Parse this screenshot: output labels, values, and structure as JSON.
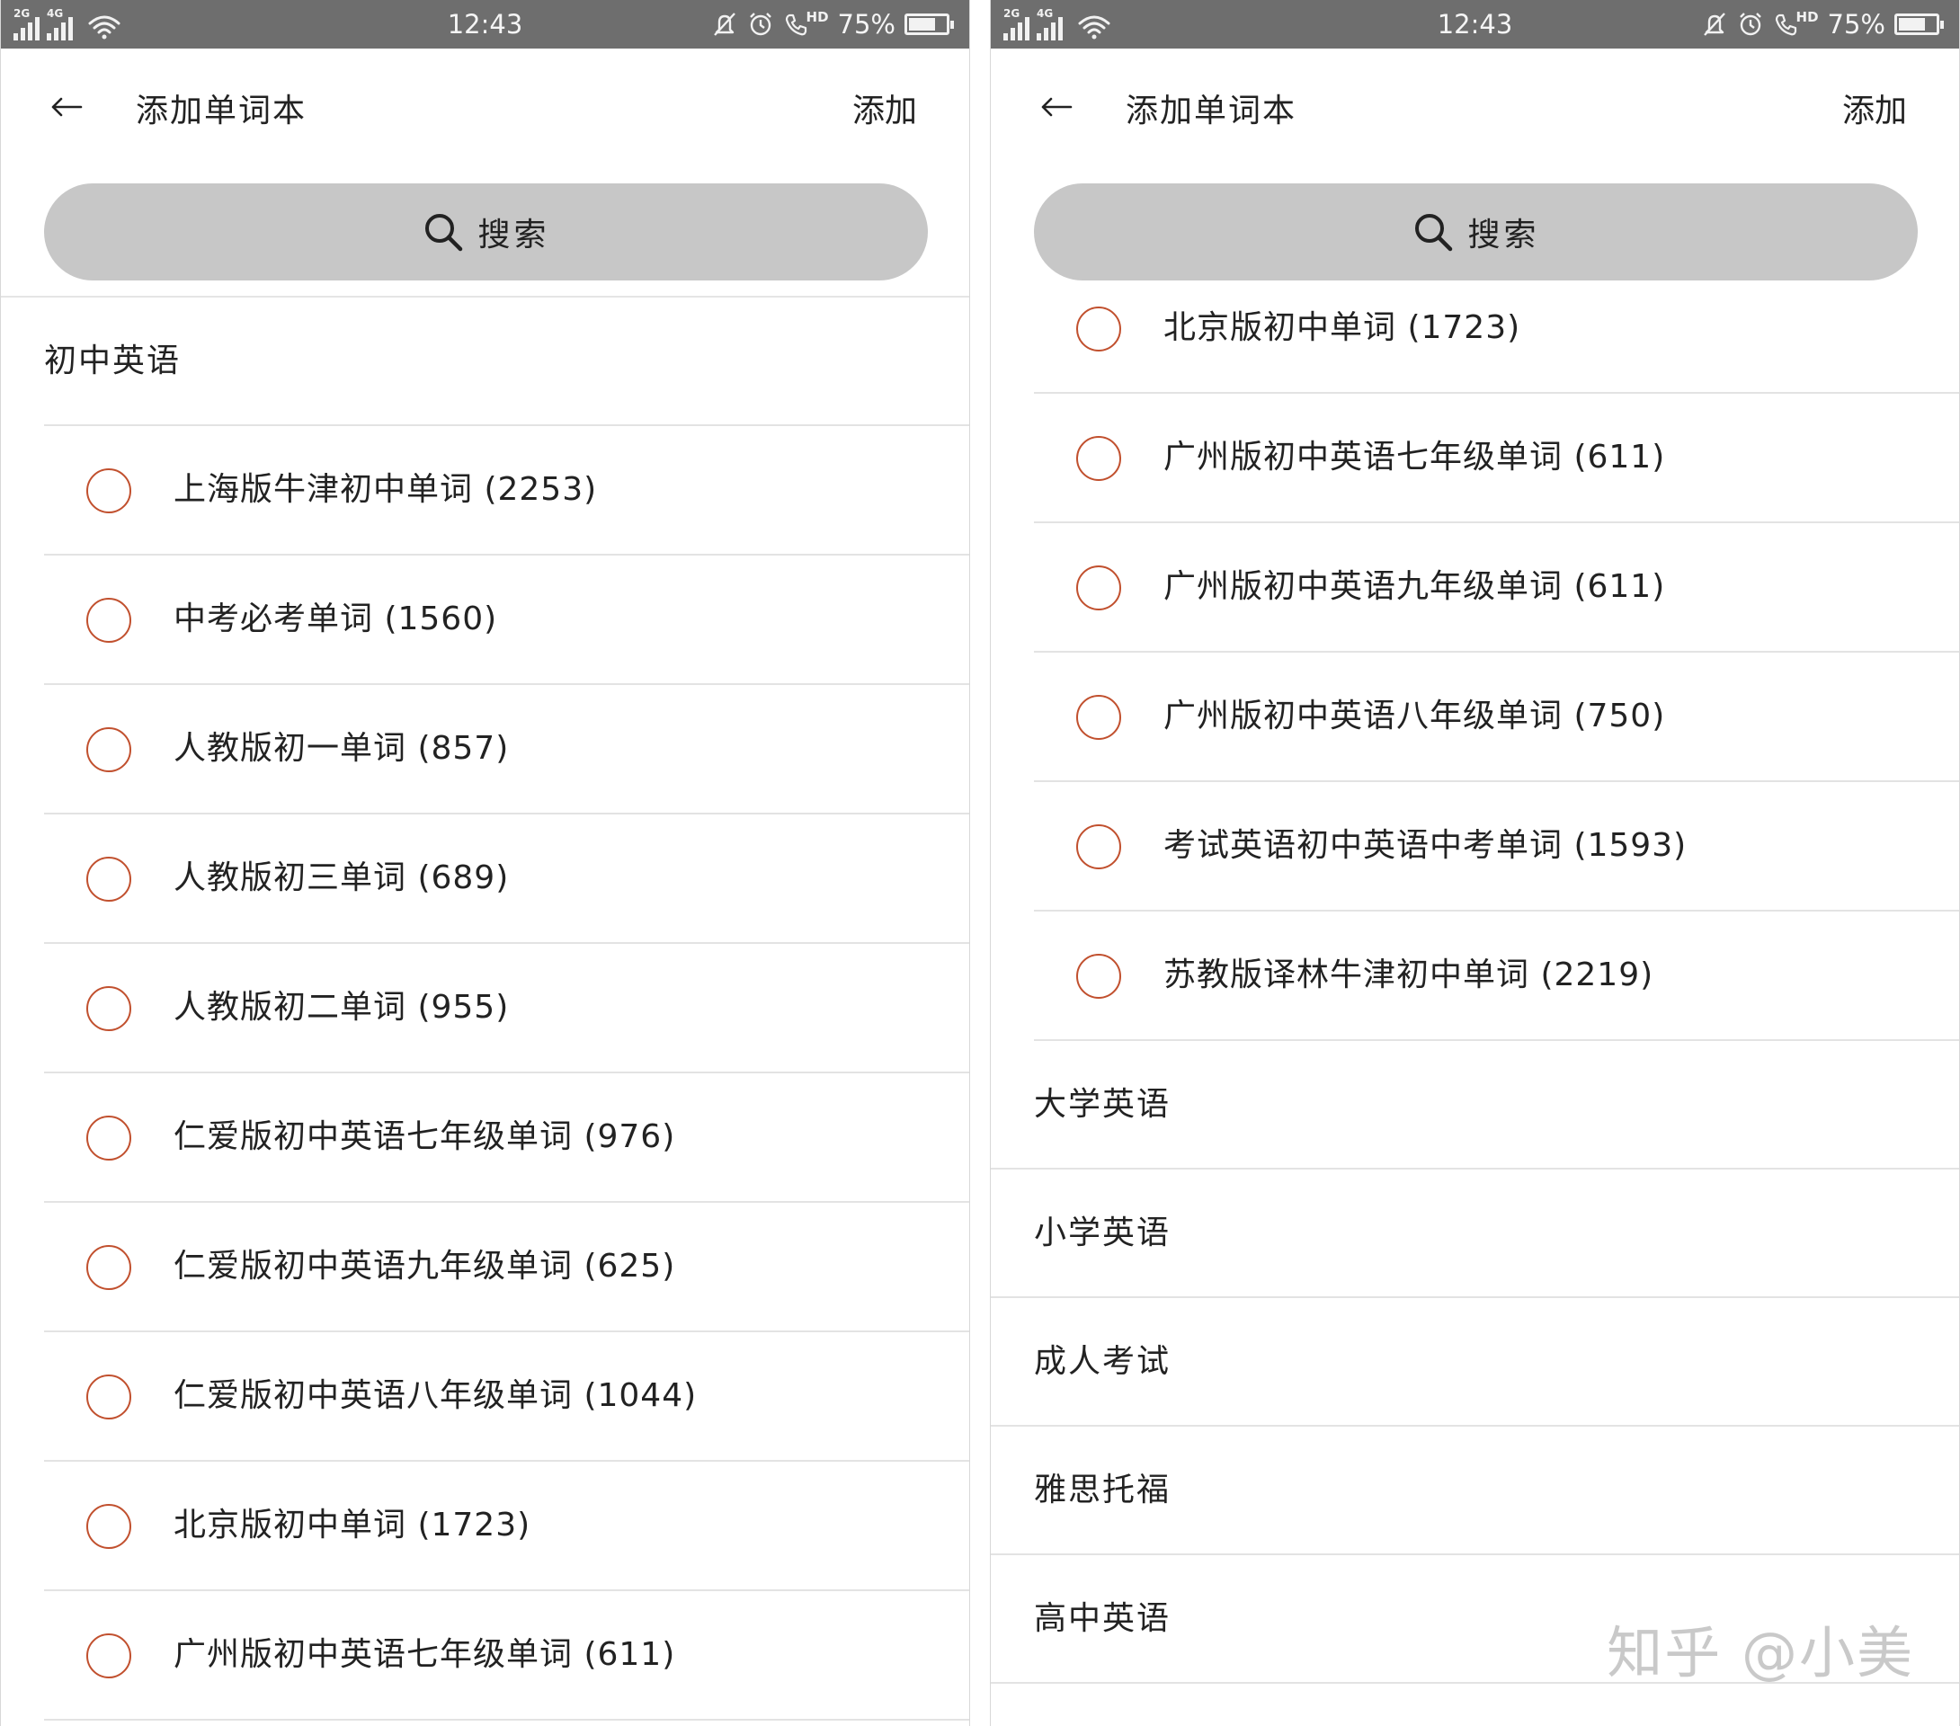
{
  "left": {
    "status_bar": {
      "sim1": "2G",
      "sim2": "4G",
      "time": "12:43",
      "hd": "HD",
      "battery_percent": "75%",
      "battery_level": 0.75
    },
    "app_bar": {
      "title": "添加单词本",
      "action": "添加"
    },
    "search": {
      "label": "搜索"
    },
    "section": "初中英语",
    "items": [
      "上海版牛津初中单词 (2253)",
      "中考必考单词 (1560)",
      "人教版初一单词 (857)",
      "人教版初三单词 (689)",
      "人教版初二单词 (955)",
      "仁爱版初中英语七年级单词 (976)",
      "仁爱版初中英语九年级单词 (625)",
      "仁爱版初中英语八年级单词 (1044)",
      "北京版初中单词 (1723)",
      "广州版初中英语七年级单词 (611)"
    ]
  },
  "right": {
    "status_bar": {
      "sim1": "2G",
      "sim2": "4G",
      "time": "12:43",
      "hd": "HD",
      "battery_percent": "75%",
      "battery_level": 0.75
    },
    "app_bar": {
      "title": "添加单词本",
      "action": "添加"
    },
    "search": {
      "label": "搜索"
    },
    "items": [
      "北京版初中单词 (1723)",
      "广州版初中英语七年级单词 (611)",
      "广州版初中英语九年级单词 (611)",
      "广州版初中英语八年级单词 (750)",
      "考试英语初中英语中考单词 (1593)",
      "苏教版译林牛津初中单词 (2219)"
    ],
    "sections": [
      "大学英语",
      "小学英语",
      "成人考试",
      "雅思托福",
      "高中英语"
    ]
  },
  "watermark": "知乎 @小美",
  "colors": {
    "status_bar": "#6e6e6e",
    "radio": "#c1502e",
    "search_bg": "#c7c7c7",
    "divider": "#e3e3e3"
  }
}
